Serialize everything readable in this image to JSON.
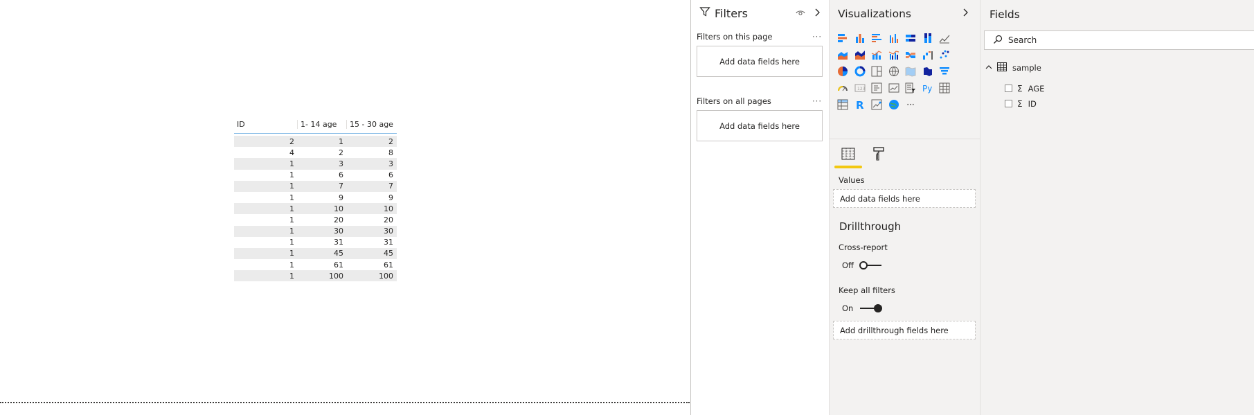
{
  "table": {
    "headers": [
      "ID",
      "1- 14 age",
      "15 - 30 age"
    ],
    "rows": [
      [
        2,
        1,
        2
      ],
      [
        4,
        2,
        8
      ],
      [
        1,
        3,
        3
      ],
      [
        1,
        6,
        6
      ],
      [
        1,
        7,
        7
      ],
      [
        1,
        9,
        9
      ],
      [
        1,
        10,
        10
      ],
      [
        1,
        20,
        20
      ],
      [
        1,
        30,
        30
      ],
      [
        1,
        31,
        31
      ],
      [
        1,
        45,
        45
      ],
      [
        1,
        61,
        61
      ],
      [
        1,
        100,
        100
      ]
    ]
  },
  "filters": {
    "title": "Filters",
    "on_this_page": "Filters on this page",
    "on_all_pages": "Filters on all pages",
    "more": "···",
    "add_fields": "Add data fields here"
  },
  "visualizations": {
    "title": "Visualizations",
    "more": "···",
    "values_label": "Values",
    "add_fields": "Add data fields here",
    "drillthrough_title": "Drillthrough",
    "cross_report_label": "Cross-report",
    "cross_report_state": "Off",
    "keep_filters_label": "Keep all filters",
    "keep_filters_state": "On",
    "add_drillthrough": "Add drillthrough fields here",
    "python_label": "Py",
    "r_label": "R"
  },
  "fields": {
    "title": "Fields",
    "search_placeholder": "Search",
    "table_name": "sample",
    "items": [
      "AGE",
      "ID"
    ],
    "sigma": "Σ"
  },
  "colors": {
    "accent_yellow": "#f2c811",
    "bar_blue": "#118dff",
    "bar_dark": "#12239e",
    "bar_orange": "#e66c37",
    "pane_bg": "#f3f2f1"
  }
}
